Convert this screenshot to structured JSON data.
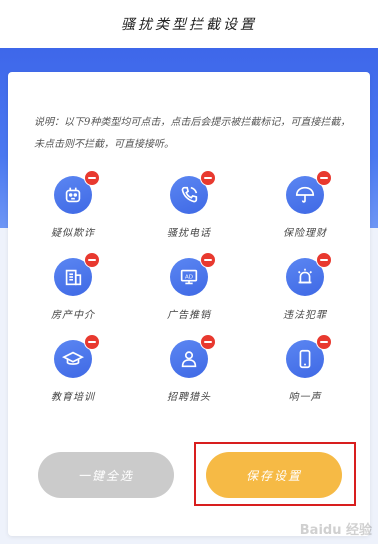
{
  "header": {
    "title": "骚扰类型拦截设置"
  },
  "description": "说明：以下9种类型均可点击，点击后会提示被拦截标记，可直接拦截，未点击则不拦截，可直接接听。",
  "items": [
    {
      "label": "疑似欺诈",
      "icon": "robot-icon"
    },
    {
      "label": "骚扰电话",
      "icon": "phone-icon"
    },
    {
      "label": "保险理财",
      "icon": "umbrella-icon"
    },
    {
      "label": "房产中介",
      "icon": "building-icon"
    },
    {
      "label": "广告推销",
      "icon": "ad-screen-icon"
    },
    {
      "label": "违法犯罪",
      "icon": "alarm-light-icon"
    },
    {
      "label": "教育培训",
      "icon": "graduation-cap-icon"
    },
    {
      "label": "招聘猎头",
      "icon": "person-icon"
    },
    {
      "label": "响一声",
      "icon": "mobile-phone-icon"
    }
  ],
  "buttons": {
    "clear_label": "一键全选",
    "save_label": "保存设置"
  },
  "watermark": "Baidu 经验",
  "colors": {
    "accent_blue": "#3f69e5",
    "badge_red": "#e8392f",
    "save_yellow": "#f6ba45",
    "disabled_gray": "#cbcbcb",
    "highlight_red": "#d81e1e"
  }
}
